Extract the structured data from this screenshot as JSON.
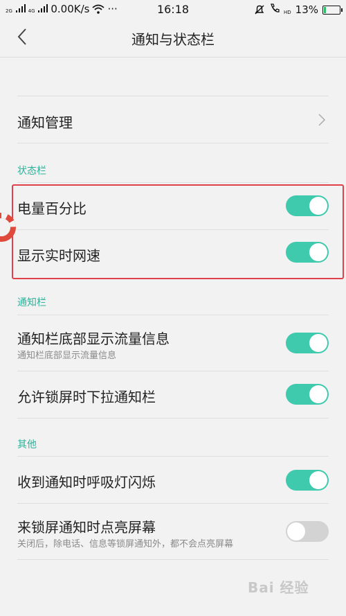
{
  "status_bar": {
    "signal_left": "2G",
    "signal_right": "4G",
    "network_speed": "0.00K/s",
    "more_dots": "···",
    "time": "16:18",
    "hd_label": "HD",
    "battery_percent": "13%",
    "battery_level": 0.13
  },
  "header": {
    "title": "通知与状态栏"
  },
  "notification_management": {
    "label": "通知管理"
  },
  "sections": {
    "status_bar": {
      "title": "状态栏",
      "items": [
        {
          "label": "电量百分比",
          "enabled": true
        },
        {
          "label": "显示实时网速",
          "enabled": true
        }
      ]
    },
    "notification_bar": {
      "title": "通知栏",
      "items": [
        {
          "label": "通知栏底部显示流量信息",
          "sublabel": "通知栏底部显示流量信息",
          "enabled": true
        },
        {
          "label": "允许锁屏时下拉通知栏",
          "enabled": true
        }
      ]
    },
    "other": {
      "title": "其他",
      "items": [
        {
          "label": "收到通知时呼吸灯闪烁",
          "enabled": true
        },
        {
          "label": "来锁屏通知时点亮屏幕",
          "sublabel": "关闭后，除电话、信息等锁屏通知外，都不会点亮屏幕",
          "enabled": false
        }
      ]
    }
  },
  "watermark": {
    "text": "Bai 经验"
  },
  "colors": {
    "accent": "#3fc9ad",
    "section_title": "#2bb39b",
    "highlight_box": "#e0404a",
    "toggle_off": "#d3d3d3"
  }
}
